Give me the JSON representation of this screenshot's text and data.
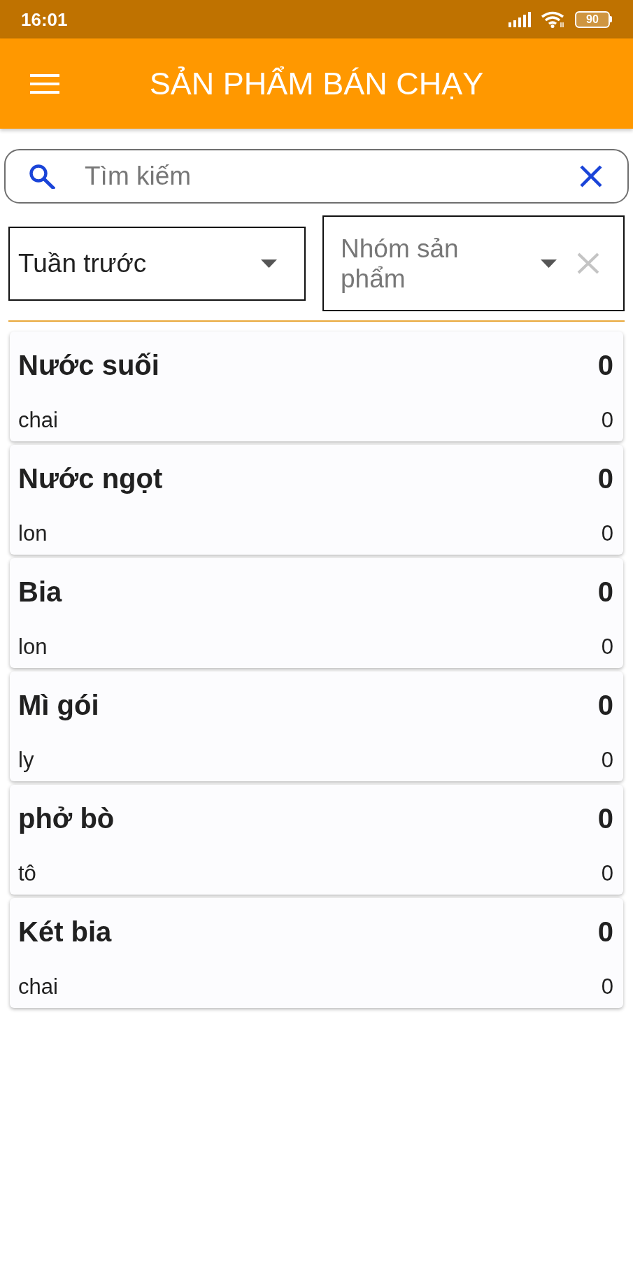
{
  "status_bar": {
    "time": "16:01",
    "battery": "90"
  },
  "app_bar": {
    "title": "SẢN PHẨM BÁN CHẠY"
  },
  "search": {
    "placeholder": "Tìm kiếm"
  },
  "filters": [
    {
      "value": "Tuần trước",
      "clear_button": false
    },
    {
      "placeholder": "Nhóm sản phẩm",
      "clear_button": true
    }
  ],
  "products": [
    {
      "name": "Nước suối",
      "main_value": "0",
      "unit": "chai",
      "unit_value": "0"
    },
    {
      "name": "Nước ngọt",
      "main_value": "0",
      "unit": "lon",
      "unit_value": "0"
    },
    {
      "name": "Bia",
      "main_value": "0",
      "unit": "lon",
      "unit_value": "0"
    },
    {
      "name": "Mì gói",
      "main_value": "0",
      "unit": "ly",
      "unit_value": "0"
    },
    {
      "name": "phở bò",
      "main_value": "0",
      "unit": "tô",
      "unit_value": "0"
    },
    {
      "name": "Két bia",
      "main_value": "0",
      "unit": "chai",
      "unit_value": "0"
    }
  ]
}
